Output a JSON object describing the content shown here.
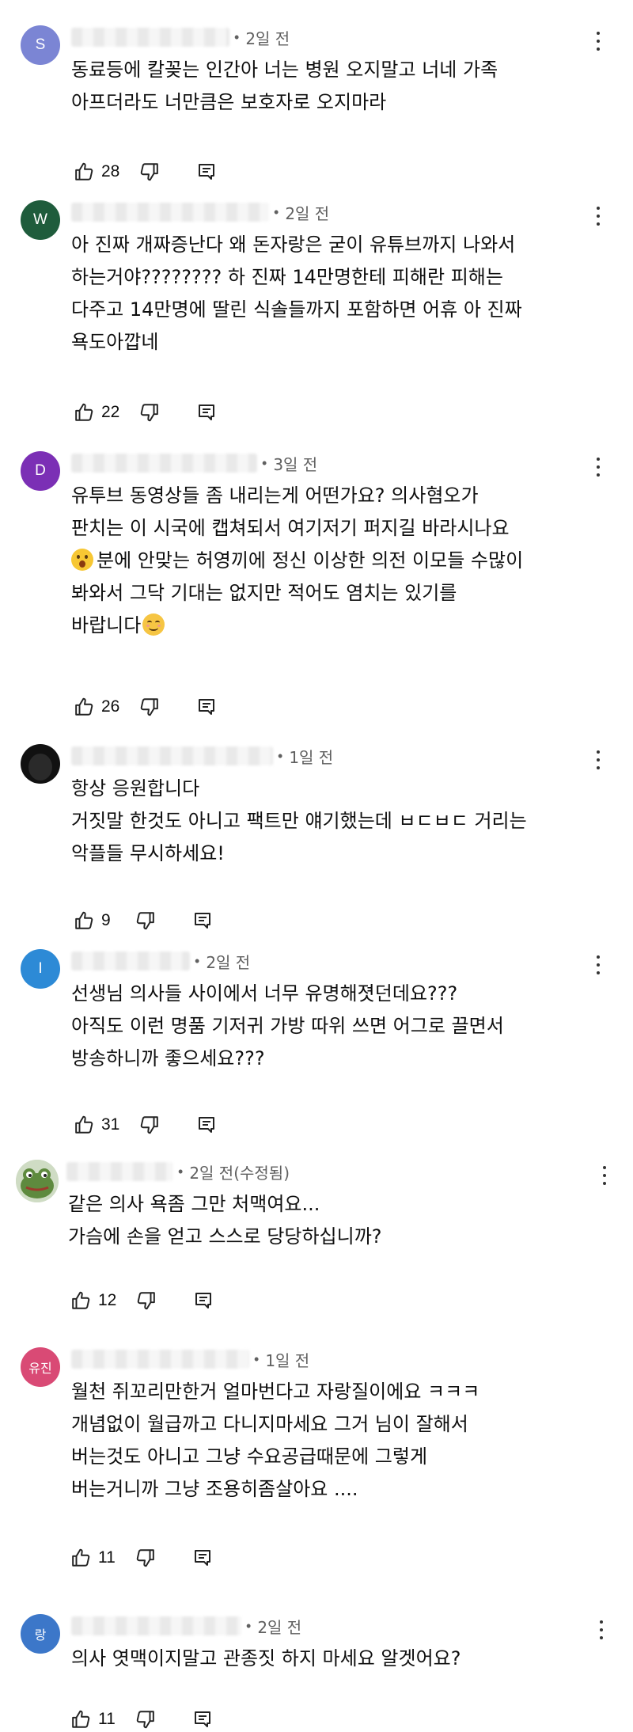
{
  "comments": [
    {
      "avatar_letter": "S",
      "avatar_color": "#7b85d4",
      "time": "2일 전",
      "lines": [
        "동료등에 칼꽂는 인간아 너는 병원 오지말고 너네 가족",
        "아프더라도 너만큼은 보호자로 오지마라"
      ],
      "likes": "28"
    },
    {
      "avatar_letter": "W",
      "avatar_color": "#1f5c3c",
      "time": "2일 전",
      "lines": [
        "아 진짜 개짜증난다 왜 돈자랑은 굳이 유튜브까지 나와서",
        "하는거야???????? 하 진짜 14만명한테 피해란 피해는",
        "다주고 14만명에 딸린 식솔들까지 포함하면 어휴 아 진짜",
        "욕도아깝네"
      ],
      "likes": "22"
    },
    {
      "avatar_letter": "D",
      "avatar_color": "#7b2fb5",
      "time": "3일 전",
      "lines": [
        "유투브 동영상들 좀 내리는게 어떤가요? 의사혐오가",
        "판치는 이 시국에 캡쳐되서 여기저기 퍼지길 바라시나요",
        "분에 안맞는 허영끼에 정신 이상한 의전 이모들 수많이",
        "봐와서 그닥 기대는 없지만 적어도 염치는 있기를",
        "바랍니다"
      ],
      "likes": "26"
    },
    {
      "avatar_letter": "",
      "avatar_color": "#111111",
      "time": "1일 전",
      "lines": [
        "항상 응원합니다",
        "거짓말 한것도 아니고 팩트만 얘기했는데 ㅂㄷㅂㄷ 거리는",
        "악플들 무시하세요!"
      ],
      "likes": "9"
    },
    {
      "avatar_letter": "I",
      "avatar_color": "#2d8ad6",
      "time": "2일 전",
      "lines": [
        "선생님 의사들 사이에서 너무 유명해졋던데요???",
        "아직도 이런 명품 기저귀 가방 따위 쓰면 어그로 끌면서",
        "방송하니까 좋으세요???"
      ],
      "likes": "31"
    },
    {
      "avatar_letter": "",
      "avatar_color": "#cfdcc4",
      "time": "2일 전(수정됨)",
      "lines": [
        "같은 의사 욕좀 그만 처맥여요...",
        "가슴에 손을 얻고 스스로 당당하십니까?"
      ],
      "likes": "12"
    },
    {
      "avatar_letter": "유진",
      "avatar_color": "#d94a75",
      "time": "1일 전",
      "lines": [
        "월천 쥐꼬리만한거 얼마번다고 자랑질이에요 ㅋㅋㅋ",
        "개념없이 월급까고 다니지마세요 그거 님이 잘해서",
        "버는것도 아니고 그냥 수요공급때문에 그렇게",
        "버는거니까 그냥 조용히좀살아요 ...."
      ],
      "likes": "11"
    },
    {
      "avatar_letter": "랑",
      "avatar_color": "#3c77c9",
      "time": "2일 전",
      "lines": [
        "의사 엿맥이지말고 관종짓 하지 마세요 알겟어요?"
      ],
      "likes": "11"
    }
  ]
}
